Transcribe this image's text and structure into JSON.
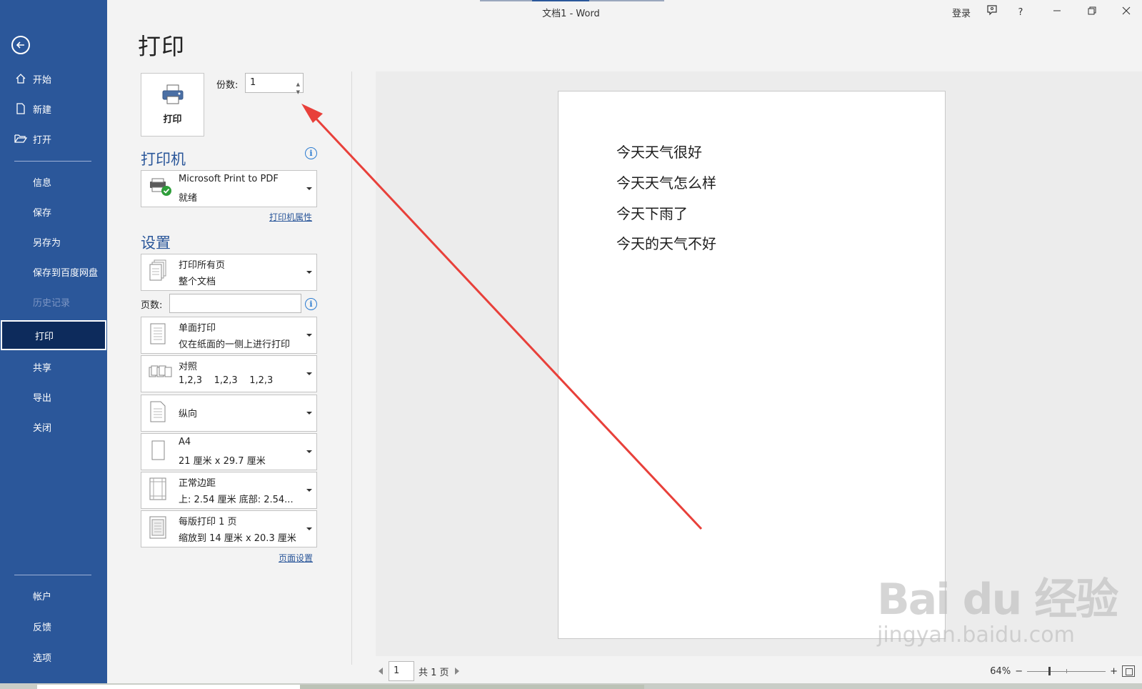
{
  "window": {
    "title": "文档1  -  Word",
    "login": "登录",
    "help": "?"
  },
  "sidebar": {
    "items": [
      {
        "label": "开始"
      },
      {
        "label": "新建"
      },
      {
        "label": "打开"
      },
      {
        "label": "信息"
      },
      {
        "label": "保存"
      },
      {
        "label": "另存为"
      },
      {
        "label": "保存到百度网盘"
      },
      {
        "label": "历史记录"
      },
      {
        "label": "打印"
      },
      {
        "label": "共享"
      },
      {
        "label": "导出"
      },
      {
        "label": "关闭"
      },
      {
        "label": "帐户"
      },
      {
        "label": "反馈"
      },
      {
        "label": "选项"
      }
    ],
    "active": "打印",
    "disabled": "历史记录"
  },
  "print": {
    "page_title": "打印",
    "button_label": "打印",
    "copies_label": "份数:",
    "copies_value": "1",
    "printer_heading": "打印机",
    "printer_name": "Microsoft Print to PDF",
    "printer_status": "就绪",
    "printer_properties": "打印机属性",
    "settings_heading": "设置",
    "pages_label": "页数:",
    "pages_value": "",
    "page_setup": "页面设置",
    "settings": [
      {
        "line1": "打印所有页",
        "line2": "整个文档"
      },
      {
        "line1": "单面打印",
        "line2": "仅在纸面的一侧上进行打印"
      },
      {
        "line1": "对照",
        "line2": "1,2,3    1,2,3    1,2,3"
      },
      {
        "line1": "纵向",
        "line2": ""
      },
      {
        "line1": "A4",
        "line2": "21 厘米 x 29.7 厘米"
      },
      {
        "line1": "正常边距",
        "line2": "上: 2.54 厘米 底部: 2.54..."
      },
      {
        "line1": "每版打印 1 页",
        "line2": "缩放到 14 厘米 x 20.3 厘米"
      }
    ]
  },
  "preview": {
    "lines": [
      "今天天气很好",
      "今天天气怎么样",
      "今天下雨了",
      "今天的天气不好"
    ],
    "current_page": "1",
    "total_pages": "共 1 页",
    "zoom": "64%"
  },
  "watermark": {
    "main": "Bai du 经验",
    "sub": "jingyan.baidu.com"
  },
  "colors": {
    "sidebar": "#2b579a",
    "sidebar_active": "#0d2b5c",
    "accent_text": "#2b579a",
    "annotation_arrow": "#e8403a"
  }
}
